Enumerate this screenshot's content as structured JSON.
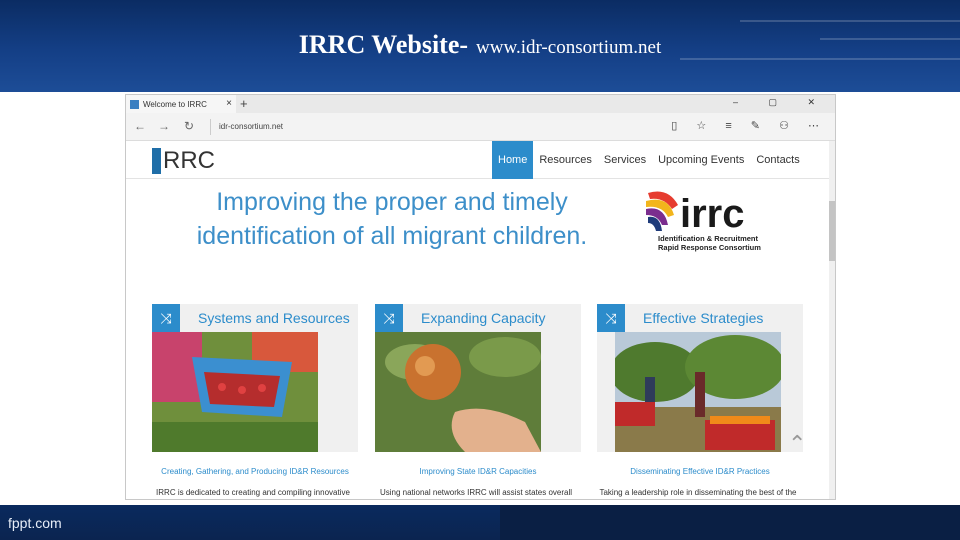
{
  "slide": {
    "title_main": "IRRC Website-",
    "title_url": "www.idr-consortium.net",
    "footer_brand": "fppt.com"
  },
  "browser": {
    "tab_title": "Welcome to IRRC",
    "tab_close": "×",
    "new_tab": "+",
    "window_controls": "– ▢ ✕",
    "back": "←",
    "forward": "→",
    "refresh": "↻",
    "url": "idr-consortium.net",
    "toolbar_icons": "▯ ☆ ≡ ✎ ⚇ ⋯"
  },
  "site": {
    "logo_text": "RRC",
    "menu": [
      {
        "label": "Home",
        "active": true
      },
      {
        "label": "Resources"
      },
      {
        "label": "Services"
      },
      {
        "label": "Upcoming Events"
      },
      {
        "label": "Contacts"
      }
    ],
    "hero_line1": "Improving the proper and timely",
    "hero_line2": "identification of all migrant children.",
    "hero_logo_word": "irrc",
    "hero_logo_sub1": "Identification & Recruitment",
    "hero_logo_sub2": "Rapid Response Consortium",
    "cards": [
      {
        "title": "Systems and Resources",
        "caption": "Creating, Gathering, and Producing ID&R Resources",
        "desc": "IRRC is dedicated to creating and compiling innovative"
      },
      {
        "title": "Expanding Capacity",
        "caption": "Improving State ID&R Capacities",
        "desc": "Using national networks IRRC will assist states overall"
      },
      {
        "title": "Effective Strategies",
        "caption": "Disseminating Effective ID&R Practices",
        "desc": "Taking a leadership role in disseminating the best of the"
      }
    ],
    "card_icon": "⤨",
    "scroll_up": "⌃"
  },
  "colors": {
    "accent": "#2c8ccb",
    "hero_text": "#3d8fc9",
    "header_dark": "#0b2c63"
  }
}
